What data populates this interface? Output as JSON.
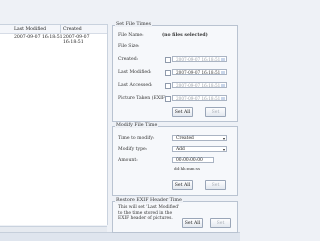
{
  "file_list": {
    "columns": [
      "Last Modified",
      "Created"
    ],
    "rows": [
      {
        "last_modified": "2007-09-07 16:18:51",
        "created": "2007-09-07 16:18:51"
      }
    ]
  },
  "set_file_times": {
    "title": "Set File Times",
    "file_name_label": "File Name:",
    "file_name_value": "(no files selected)",
    "file_size_label": "File Size:",
    "created_label": "Created:",
    "created_value": "2007-09-07 16:18:51",
    "last_modified_label": "Last Modified:",
    "last_modified_value": "2007-09-07 16:18:51",
    "last_accessed_label": "Last Accessed:",
    "last_accessed_value": "2007-09-07 16:18:51",
    "picture_taken_label": "Picture Taken (EXIF):",
    "picture_taken_value": "2007-09-07 16:18:51",
    "set_all_label": "Set All",
    "set_label": "Set"
  },
  "modify_file_time": {
    "title": "Modify File Time",
    "time_to_modify_label": "Time to modify:",
    "time_to_modify_value": "Created",
    "modify_type_label": "Modify type:",
    "modify_type_value": "Add",
    "amount_label": "Amount:",
    "amount_value": "00:00:00:00",
    "amount_format": "dd:hh:mm:ss",
    "set_all_label": "Set All",
    "set_label": "Set"
  },
  "restore_exif": {
    "title": "Restore EXIF Header Time",
    "description": "This will set 'Last Modified' to the time stored in the EXIF header of pictures.",
    "set_all_label": "Set All",
    "set_label": "Set"
  },
  "colors": {
    "background": "#eef1f6",
    "list_background": "#ffffff",
    "border": "#b9c3d1"
  }
}
